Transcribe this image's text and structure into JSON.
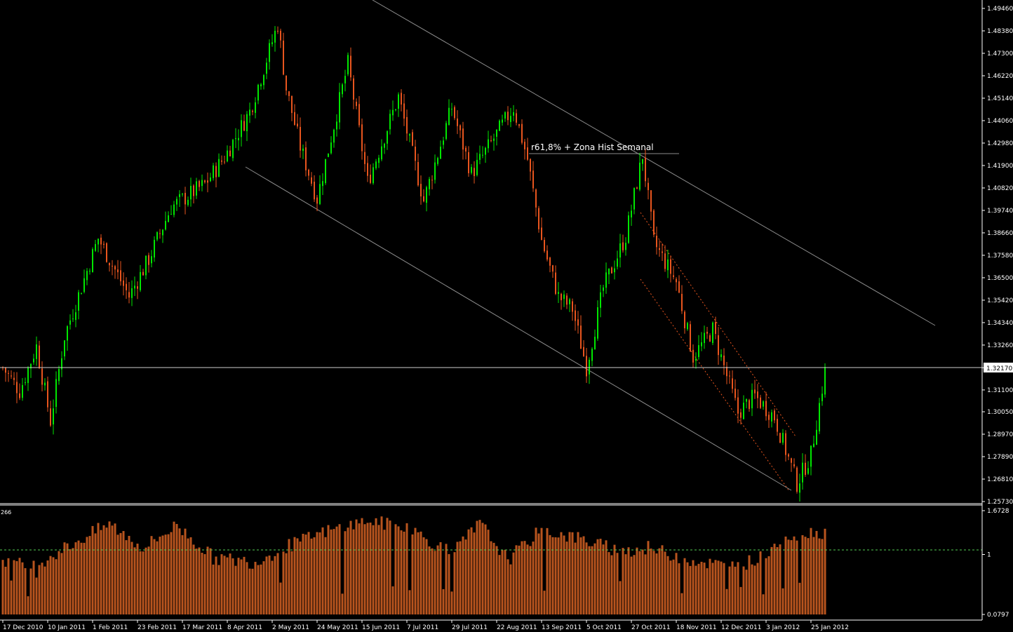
{
  "chart_data": [
    {
      "type": "candlestick",
      "colors": {
        "up": "#00e600",
        "down": "#e8551e",
        "background": "#000000",
        "axis": "#ffffff"
      },
      "y_ticks": [
        "1.49460",
        "1.48380",
        "1.47300",
        "1.46220",
        "1.45140",
        "1.44060",
        "1.42980",
        "1.41900",
        "1.40820",
        "1.39740",
        "1.38660",
        "1.37580",
        "1.36500",
        "1.35420",
        "1.34340",
        "1.33260",
        "1.32170",
        "1.31100",
        "1.30050",
        "1.28970",
        "1.27890",
        "1.26810",
        "1.25730"
      ],
      "ylim": [
        1.2573,
        1.4946
      ],
      "current_price": "1.32170",
      "annotation": "r61,8% + Zona Hist Semanal",
      "x_ticks": [
        "17 Dec 2010",
        "10 Jan 2011",
        "1 Feb 2011",
        "23 Feb 2011",
        "17 Mar 2011",
        "8 Apr 2011",
        "2 May 2011",
        "24 May 2011",
        "15 Jun 2011",
        "7 Jul 2011",
        "29 Jul 2011",
        "22 Aug 2011",
        "13 Sep 2011",
        "5 Oct 2011",
        "27 Oct 2011",
        "18 Nov 2011",
        "12 Dec 2011",
        "3 Jan 2012",
        "25 Jan 2012"
      ],
      "anchors": [
        {
          "i": 0,
          "p": 1.3217
        },
        {
          "i": 6,
          "p": 1.3105
        },
        {
          "i": 12,
          "p": 1.332
        },
        {
          "i": 17,
          "p": 1.296
        },
        {
          "i": 22,
          "p": 1.337
        },
        {
          "i": 34,
          "p": 1.384
        },
        {
          "i": 45,
          "p": 1.356
        },
        {
          "i": 52,
          "p": 1.374
        },
        {
          "i": 60,
          "p": 1.399
        },
        {
          "i": 72,
          "p": 1.41
        },
        {
          "i": 79,
          "p": 1.423
        },
        {
          "i": 88,
          "p": 1.445
        },
        {
          "i": 98,
          "p": 1.487
        },
        {
          "i": 101,
          "p": 1.456
        },
        {
          "i": 106,
          "p": 1.428
        },
        {
          "i": 112,
          "p": 1.403
        },
        {
          "i": 123,
          "p": 1.468
        },
        {
          "i": 130,
          "p": 1.411
        },
        {
          "i": 141,
          "p": 1.452
        },
        {
          "i": 150,
          "p": 1.402
        },
        {
          "i": 160,
          "p": 1.447
        },
        {
          "i": 167,
          "p": 1.415
        },
        {
          "i": 182,
          "p": 1.447
        },
        {
          "i": 187,
          "p": 1.422
        },
        {
          "i": 192,
          "p": 1.383
        },
        {
          "i": 198,
          "p": 1.356
        },
        {
          "i": 203,
          "p": 1.35
        },
        {
          "i": 208,
          "p": 1.322
        },
        {
          "i": 214,
          "p": 1.36
        },
        {
          "i": 222,
          "p": 1.385
        },
        {
          "i": 228,
          "p": 1.424
        },
        {
          "i": 232,
          "p": 1.382
        },
        {
          "i": 240,
          "p": 1.363
        },
        {
          "i": 246,
          "p": 1.327
        },
        {
          "i": 253,
          "p": 1.34
        },
        {
          "i": 262,
          "p": 1.3
        },
        {
          "i": 268,
          "p": 1.308
        },
        {
          "i": 275,
          "p": 1.298
        },
        {
          "i": 283,
          "p": 1.266
        },
        {
          "i": 288,
          "p": 1.28
        },
        {
          "i": 293,
          "p": 1.32
        }
      ]
    },
    {
      "type": "bar",
      "name": "266",
      "colors": {
        "bar": "#b8541e",
        "level_line": "#55cc55"
      },
      "y_ticks": [
        "1.6728",
        "1",
        "0.0797"
      ],
      "ylim": [
        0.0797,
        1.6728
      ],
      "level": 1,
      "anchors": [
        {
          "i": 0,
          "p": 0.92
        },
        {
          "i": 10,
          "p": 0.8
        },
        {
          "i": 20,
          "p": 1.05
        },
        {
          "i": 38,
          "p": 1.47
        },
        {
          "i": 50,
          "p": 1.1
        },
        {
          "i": 62,
          "p": 1.45
        },
        {
          "i": 75,
          "p": 0.95
        },
        {
          "i": 90,
          "p": 0.88
        },
        {
          "i": 100,
          "p": 1.1
        },
        {
          "i": 115,
          "p": 1.35
        },
        {
          "i": 130,
          "p": 1.52
        },
        {
          "i": 145,
          "p": 1.4
        },
        {
          "i": 160,
          "p": 1.0
        },
        {
          "i": 170,
          "p": 1.48
        },
        {
          "i": 180,
          "p": 0.92
        },
        {
          "i": 192,
          "p": 1.38
        },
        {
          "i": 205,
          "p": 1.25
        },
        {
          "i": 220,
          "p": 1.05
        },
        {
          "i": 230,
          "p": 1.1
        },
        {
          "i": 245,
          "p": 0.92
        },
        {
          "i": 260,
          "p": 0.8
        },
        {
          "i": 270,
          "p": 0.95
        },
        {
          "i": 280,
          "p": 1.3
        },
        {
          "i": 293,
          "p": 1.35
        }
      ]
    }
  ]
}
